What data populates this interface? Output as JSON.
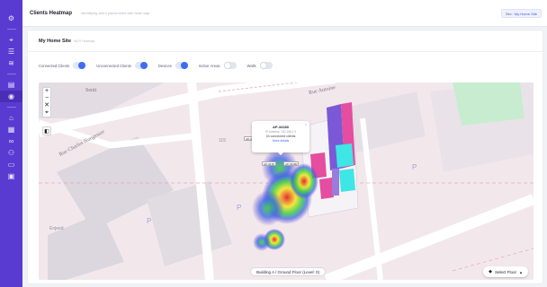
{
  "sidebar": {
    "items": [
      {
        "icon": "gear-icon",
        "glyph": "⚙",
        "active": false
      },
      {
        "icon": "location-icon",
        "glyph": "⌖",
        "active": false
      },
      {
        "icon": "list-icon",
        "glyph": "☰",
        "active": false
      },
      {
        "icon": "wifi-icon",
        "glyph": "≋",
        "active": false
      },
      {
        "icon": "chart-icon",
        "glyph": "▤",
        "active": false
      },
      {
        "icon": "heatmap-icon",
        "glyph": "◉",
        "active": true
      },
      {
        "icon": "home-icon",
        "glyph": "⌂",
        "active": false
      },
      {
        "icon": "building-icon",
        "glyph": "▦",
        "active": false
      },
      {
        "icon": "link-icon",
        "glyph": "∞",
        "active": false
      },
      {
        "icon": "users-icon",
        "glyph": "⚇",
        "active": false
      },
      {
        "icon": "document-icon",
        "glyph": "▭",
        "active": false
      },
      {
        "icon": "report-icon",
        "glyph": "▣",
        "active": false
      }
    ]
  },
  "topbar": {
    "title": "Clients Heatmap",
    "subtitle": "Identifying client placements with heat map",
    "site_label": "Site:",
    "site_value": "My Home Site"
  },
  "card": {
    "title": "My Home Site",
    "subtitle": "Wi-Fi Heatmap"
  },
  "toggles": [
    {
      "label": "Connected Clients",
      "on": true
    },
    {
      "label": "Unconnected Clients",
      "on": true
    },
    {
      "label": "Devices",
      "on": true
    },
    {
      "label": "Indoor Areas",
      "on": false
    },
    {
      "label": "Walls",
      "on": false
    }
  ],
  "map": {
    "streets": [
      "Senit",
      "Rue Antoine",
      "Rue Charles Nungesser"
    ],
    "labels": [
      "115",
      "P",
      "P",
      "P",
      "Enjeed"
    ],
    "zoom_in": "+",
    "zoom_out": "−",
    "reset": "✕",
    "locate": "⌖",
    "layers": "◧",
    "ap_pins": [
      "AP-34180",
      "AP-3418",
      "AP-34180"
    ],
    "popup": {
      "ap_name": "AP-34180",
      "ip": "IP Address: 192.168.1.3",
      "clients": "24 connected clients",
      "more": "More details",
      "close": "×"
    },
    "floor_label": "Building A / Ground Floor (Level: 0)",
    "select_floor": "Select Floor",
    "heat_colors": {
      "hot": "#e8222e",
      "warm": "#f3e62a",
      "mid": "#3fcf44",
      "cool": "#3b68e8",
      "cold": "#6a3cc9"
    }
  },
  "colors": {
    "sidebar": "#5a3bd1",
    "accent": "#3e6df0",
    "building_pink": "#e44da0",
    "building_cyan": "#3ee6e6",
    "building_purple": "#7b59d6"
  }
}
